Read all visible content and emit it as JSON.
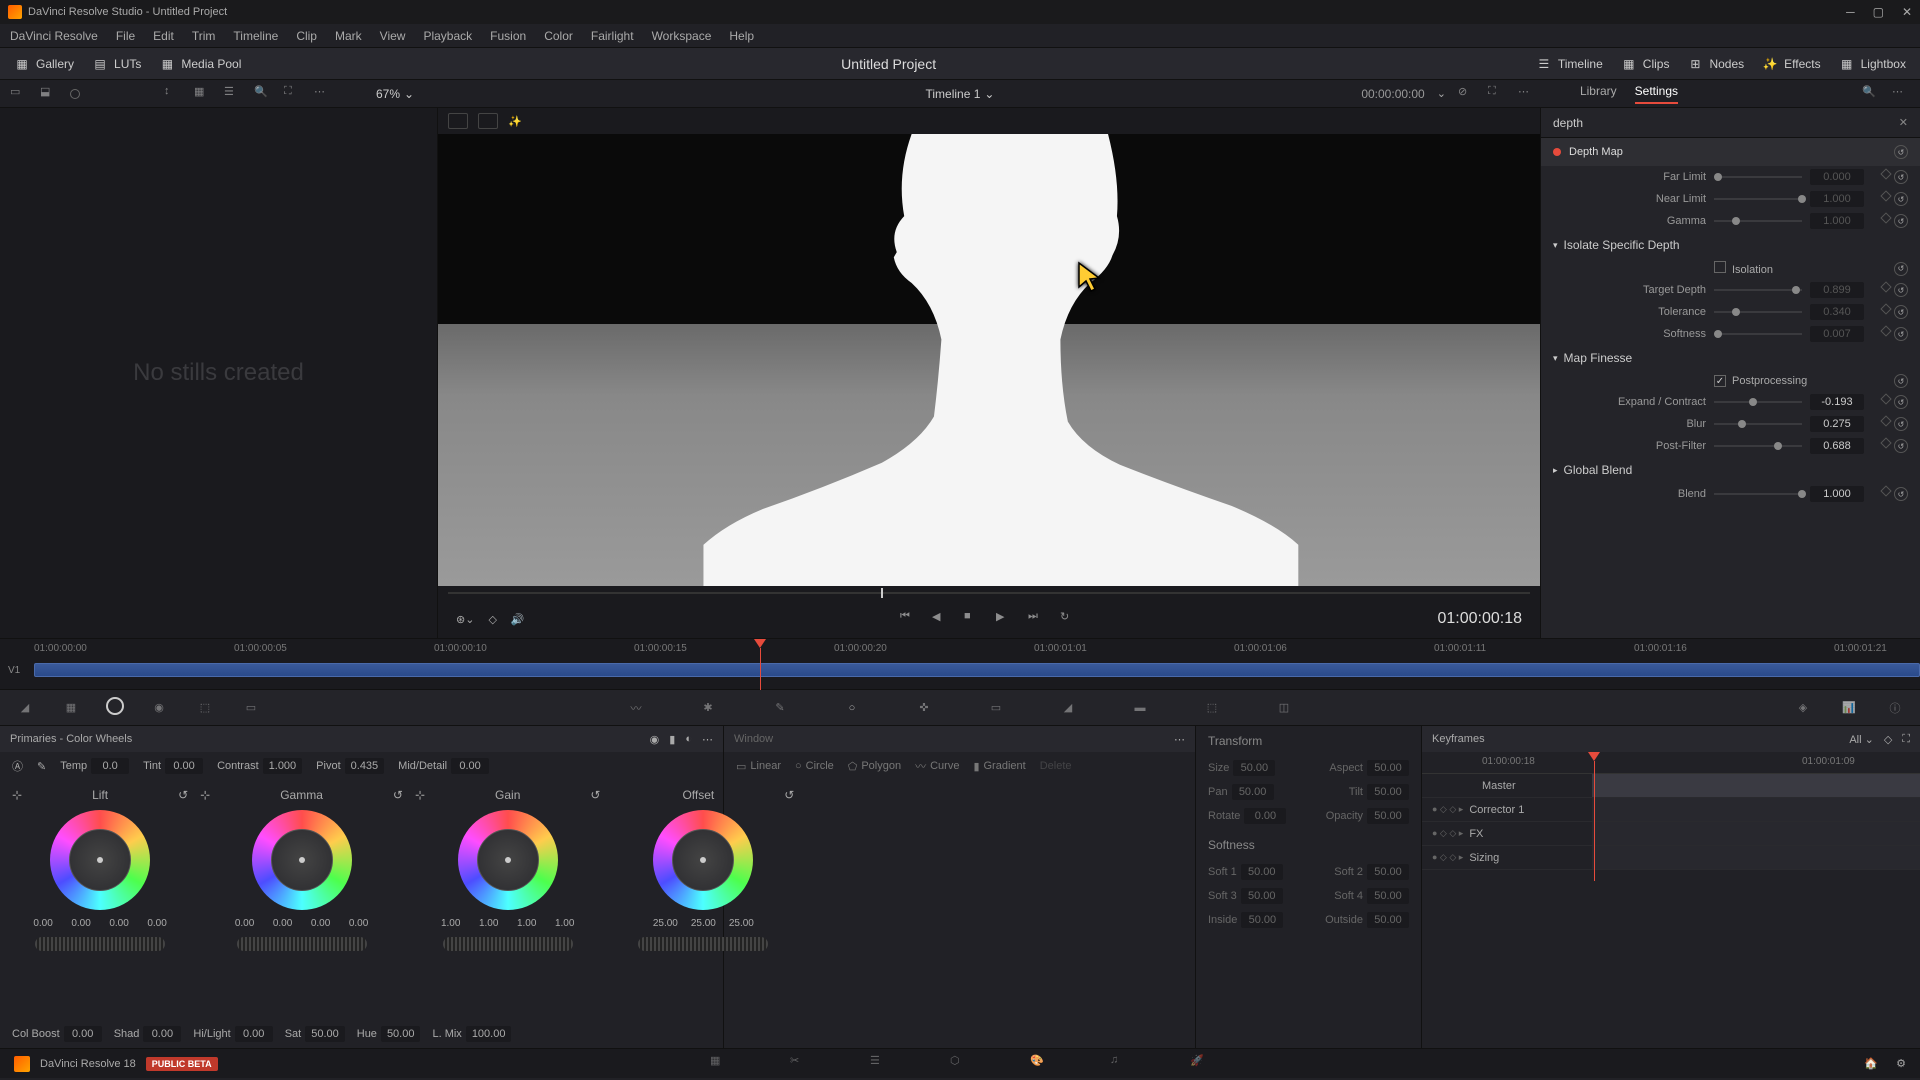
{
  "titlebar": {
    "app": "DaVinci Resolve Studio",
    "project": "Untitled Project"
  },
  "menus": [
    "DaVinci Resolve",
    "File",
    "Edit",
    "Trim",
    "Timeline",
    "Clip",
    "Mark",
    "View",
    "Playback",
    "Fusion",
    "Color",
    "Fairlight",
    "Workspace",
    "Help"
  ],
  "topbar": {
    "gallery": "Gallery",
    "luts": "LUTs",
    "mediapool": "Media Pool",
    "project_title": "Untitled Project",
    "timeline": "Timeline",
    "clips": "Clips",
    "nodes": "Nodes",
    "effects": "Effects",
    "lightbox": "Lightbox"
  },
  "subbar": {
    "zoom": "67%",
    "timeline_name": "Timeline 1",
    "tc": "00:00:00:00",
    "tab_library": "Library",
    "tab_settings": "Settings"
  },
  "gallery": {
    "empty": "No stills created"
  },
  "transport": {
    "tc": "01:00:00:18"
  },
  "inspector": {
    "search": "depth",
    "effect_name": "Depth Map",
    "far_limit": {
      "label": "Far Limit",
      "value": "0.000"
    },
    "near_limit": {
      "label": "Near Limit",
      "value": "1.000"
    },
    "gamma": {
      "label": "Gamma",
      "value": "1.000"
    },
    "isolate_title": "Isolate Specific Depth",
    "isolation": {
      "label": "Isolation"
    },
    "target_depth": {
      "label": "Target Depth",
      "value": "0.899"
    },
    "tolerance": {
      "label": "Tolerance",
      "value": "0.340"
    },
    "softness": {
      "label": "Softness",
      "value": "0.007"
    },
    "finesse_title": "Map Finesse",
    "postprocessing": {
      "label": "Postprocessing"
    },
    "expand": {
      "label": "Expand / Contract",
      "value": "-0.193"
    },
    "blur": {
      "label": "Blur",
      "value": "0.275"
    },
    "postfilter": {
      "label": "Post-Filter",
      "value": "0.688"
    },
    "global_title": "Global Blend",
    "blend": {
      "label": "Blend",
      "value": "1.000"
    }
  },
  "timeline": {
    "ticks": [
      "01:00:00:00",
      "01:00:00:05",
      "01:00:00:10",
      "01:00:00:15",
      "01:00:00:20",
      "01:00:01:01",
      "01:00:01:06",
      "01:00:01:11",
      "01:00:01:16",
      "01:00:01:21"
    ],
    "track_label": "V1"
  },
  "primaries": {
    "title": "Primaries - Color Wheels",
    "temp": {
      "label": "Temp",
      "value": "0.0"
    },
    "tint": {
      "label": "Tint",
      "value": "0.00"
    },
    "contrast": {
      "label": "Contrast",
      "value": "1.000"
    },
    "pivot": {
      "label": "Pivot",
      "value": "0.435"
    },
    "middetail": {
      "label": "Mid/Detail",
      "value": "0.00"
    },
    "lift": {
      "label": "Lift",
      "vals": [
        "0.00",
        "0.00",
        "0.00",
        "0.00"
      ]
    },
    "gamma": {
      "label": "Gamma",
      "vals": [
        "0.00",
        "0.00",
        "0.00",
        "0.00"
      ]
    },
    "gain": {
      "label": "Gain",
      "vals": [
        "1.00",
        "1.00",
        "1.00",
        "1.00"
      ]
    },
    "offset": {
      "label": "Offset",
      "vals": [
        "25.00",
        "25.00",
        "25.00"
      ]
    },
    "colboost": {
      "label": "Col Boost",
      "value": "0.00"
    },
    "shad": {
      "label": "Shad",
      "value": "0.00"
    },
    "hilight": {
      "label": "Hi/Light",
      "value": "0.00"
    },
    "sat": {
      "label": "Sat",
      "value": "50.00"
    },
    "hue": {
      "label": "Hue",
      "value": "50.00"
    },
    "lmix": {
      "label": "L. Mix",
      "value": "100.00"
    }
  },
  "window": {
    "title": "Window",
    "linear": "Linear",
    "circle": "Circle",
    "polygon": "Polygon",
    "curve": "Curve",
    "gradient": "Gradient",
    "delete": "Delete"
  },
  "transform": {
    "title": "Transform",
    "size": {
      "label": "Size",
      "value": "50.00"
    },
    "aspect": {
      "label": "Aspect",
      "value": "50.00"
    },
    "pan": {
      "label": "Pan",
      "value": "50.00"
    },
    "tilt": {
      "label": "Tilt",
      "value": "50.00"
    },
    "rotate": {
      "label": "Rotate",
      "value": "0.00"
    },
    "opacity": {
      "label": "Opacity",
      "value": "50.00"
    },
    "softness_title": "Softness",
    "soft1": {
      "label": "Soft 1",
      "value": "50.00"
    },
    "soft2": {
      "label": "Soft 2",
      "value": "50.00"
    },
    "soft3": {
      "label": "Soft 3",
      "value": "50.00"
    },
    "soft4": {
      "label": "Soft 4",
      "value": "50.00"
    },
    "inside": {
      "label": "Inside",
      "value": "50.00"
    },
    "outside": {
      "label": "Outside",
      "value": "50.00"
    }
  },
  "keyframes": {
    "title": "Keyframes",
    "all": "All",
    "ticks": [
      "01:00:00:18",
      "01:00:01:09"
    ],
    "master": "Master",
    "corrector": "Corrector 1",
    "fx": "FX",
    "sizing": "Sizing"
  },
  "pagebar": {
    "app": "DaVinci Resolve 18",
    "beta": "PUBLIC BETA"
  }
}
